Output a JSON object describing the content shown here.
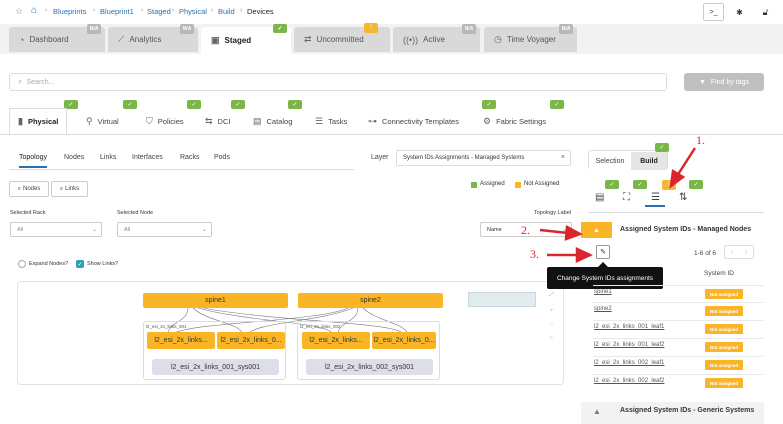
{
  "breadcrumb": {
    "items": [
      "Blueprints",
      "Blueprint1",
      "Staged",
      "Physical",
      "Build"
    ],
    "current": "Devices"
  },
  "main_tabs": [
    {
      "label": "Dashboard",
      "badge": "N/A"
    },
    {
      "label": "Analytics",
      "badge": "N/A"
    },
    {
      "label": "Staged",
      "badge": ""
    },
    {
      "label": "Uncommitted",
      "badge": ""
    },
    {
      "label": "Active",
      "badge": "N/A"
    },
    {
      "label": "Time Voyager",
      "badge": "N/A"
    }
  ],
  "search": {
    "placeholder": "Search...",
    "find_by_tags": "Find by tags"
  },
  "sub_tabs": [
    "Physical",
    "Virtual",
    "Policies",
    "DCI",
    "Catalog",
    "Tasks",
    "Connectivity Templates",
    "Fabric Settings"
  ],
  "view_tabs": [
    "Topology",
    "Nodes",
    "Links",
    "Interfaces",
    "Racks",
    "Pods"
  ],
  "layer": {
    "label": "Layer",
    "value": "System IDs Assignments - Managed Systems"
  },
  "legend": {
    "assigned": "Assigned",
    "not_assigned": "Not Assigned"
  },
  "toggle_buttons": {
    "nodes": "Nodes",
    "links": "Links"
  },
  "filters": {
    "selected_rack": "Selected Rack",
    "selected_node": "Selected Node",
    "topology_label": "Topology Label",
    "rack_value": "All",
    "node_value": "All",
    "label_value": "Name"
  },
  "checkboxes": {
    "expand_nodes": "Expand Nodes?",
    "show_links": "Show Links?"
  },
  "topology": {
    "spines": [
      "spine1",
      "spine2"
    ],
    "groups": [
      {
        "label": "l2_esi_2x_links_001",
        "leaves": [
          "l2_esi_2x_links...",
          "l2_esi_2x_links_0..."
        ],
        "system": "l2_esi_2x_links_001_sys001"
      },
      {
        "label": "l2_esi_2x_links_002",
        "leaves": [
          "l2_esi_2x_links...",
          "l2_esi_2x_links_0..."
        ],
        "system": "l2_esi_2x_links_002_sys001"
      }
    ]
  },
  "right_panel": {
    "tabs": [
      "Selection",
      "Build"
    ],
    "section1_title": "Assigned System IDs - Managed Nodes",
    "pagination": "1-6 of 6",
    "tooltip": "Change System IDs assignments",
    "column_system_id": "System ID",
    "rows": [
      {
        "name": "spine1",
        "status": "Not assigned"
      },
      {
        "name": "spine2",
        "status": "Not assigned"
      },
      {
        "name": "l2_esi_2x_links_001_leaf1",
        "status": "Not assigned"
      },
      {
        "name": "l2_esi_2x_links_001_leaf2",
        "status": "Not assigned"
      },
      {
        "name": "l2_esi_2x_links_002_leaf1",
        "status": "Not assigned"
      },
      {
        "name": "l2_esi_2x_links_002_leaf2",
        "status": "Not assigned"
      }
    ],
    "section2_title": "Assigned System IDs - Generic Systems"
  },
  "annotations": [
    "1.",
    "2.",
    "3."
  ],
  "colors": {
    "assigned": "#7ab648",
    "not_assigned": "#f9b526",
    "link": "#2a6fb0",
    "annotation": "#d8262c"
  }
}
